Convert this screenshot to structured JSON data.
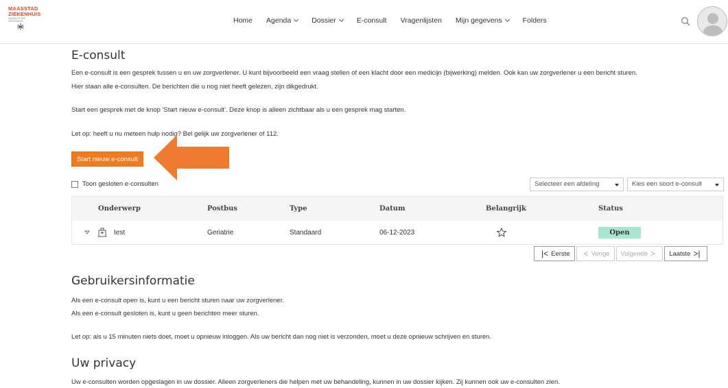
{
  "brand": {
    "line1": "MAASSTAD",
    "line2": "ZIEKENHUIS",
    "tagline": "SAMEN BETER ZIEKENHUIS",
    "accent_color": "#e8451f"
  },
  "nav": {
    "items": [
      {
        "label": "Home",
        "dropdown": false
      },
      {
        "label": "Agenda",
        "dropdown": true
      },
      {
        "label": "Dossier",
        "dropdown": true
      },
      {
        "label": "E-consult",
        "dropdown": false
      },
      {
        "label": "Vragenlijsten",
        "dropdown": false
      },
      {
        "label": "Mijn gegevens",
        "dropdown": true
      },
      {
        "label": "Folders",
        "dropdown": false
      }
    ],
    "search_icon": "search-icon",
    "avatar_icon": "user-avatar-icon"
  },
  "econsult": {
    "title": "E-consult",
    "intro_line1": "Een e-consult is een gesprek tussen u en uw zorgverlener. U kunt bijvoorbeeld een vraag stellen of een klacht door een medicijn (bijwerking) melden. Ook kan uw zorgverlener u een bericht sturen.",
    "intro_line2": "Hier staan alle e-consulten. De berichten die u nog niet heeft gelezen, zijn dikgedrukt.",
    "start_info": "Start een gesprek met de knop 'Start nieuw e-consult'. Deze knop is alleen zichtbaar als u een gesprek mag starten.",
    "warning": "Let op: heeft u nu meteen hulp nodig? Bel gelijk uw zorgverlener of 112.",
    "start_button": "Start nieuw e-consult",
    "button_color": "#f07c1f",
    "show_closed_label": "Toon gesloten e-consulten",
    "department_select": "Selecteer een afdeling",
    "type_select": "Kies een soort e-consult"
  },
  "table": {
    "headers": {
      "subject": "Onderwerp",
      "mailbox": "Postbus",
      "type": "Type",
      "date": "Datum",
      "important": "Belangrijk",
      "status": "Status"
    },
    "rows": [
      {
        "subject": "test",
        "mailbox": "Geriatrie",
        "type": "Standaard",
        "date": "06-12-2023",
        "status": "Open"
      }
    ],
    "status_color": "#a9e6cf"
  },
  "pager": {
    "first": "Eerste",
    "previous": "Vorige",
    "next": "Volgende",
    "last": "Laatste"
  },
  "user_info": {
    "title": "Gebruikersinformatie",
    "line1": "Als een e-consult open is, kunt u een bericht sturen naar uw zorgverlener.",
    "line2": "Als een e-consult gesloten is, kunt u geen berichten meer sturen.",
    "timeout": "Let op: als u 15 minuten niets doet, moet u opnieuw inloggen. Als uw bericht dan nog niet is verzonden, moet u deze opnieuw schrijven en sturen."
  },
  "privacy": {
    "title": "Uw privacy",
    "text": "Uw e-consulten worden opgeslagen in uw dossier. Alleen zorgverleners die helpen met uw behandeling, kunnen in uw dossier kijken. Zij kunnen ook uw e-consulten zien."
  },
  "annotation": {
    "arrow_color": "#ee7b30"
  }
}
